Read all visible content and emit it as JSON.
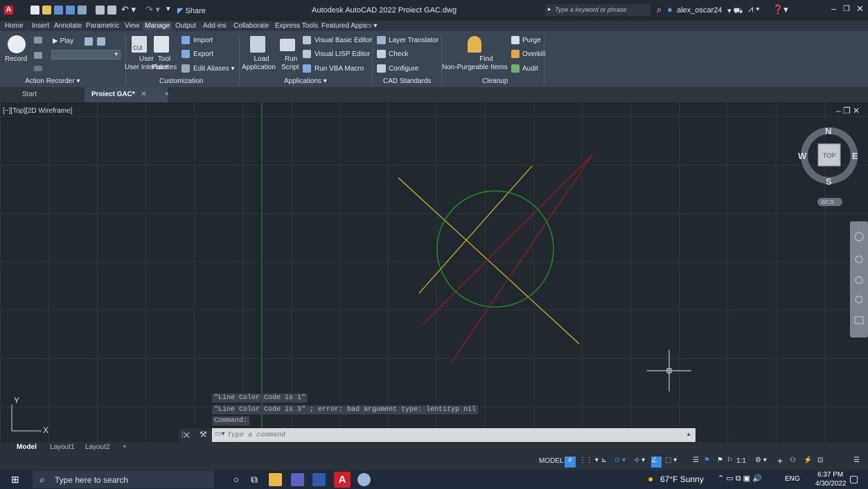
{
  "title_bar": {
    "app_title": "Autodesk AutoCAD 2022  Proiect GAC.dwg",
    "share_label": "Share",
    "search_placeholder": "Type a keyword or phrase",
    "user": "alex_oscar24"
  },
  "ribbon_tabs": [
    "Home",
    "Insert",
    "Annotate",
    "Parametric",
    "View",
    "Manage",
    "Output",
    "Add-ins",
    "Collaborate",
    "Express Tools",
    "Featured Apps"
  ],
  "active_tab": "Manage",
  "panels": {
    "action_recorder": {
      "title": "Action Recorder",
      "record": "Record",
      "play": "Play"
    },
    "customization": {
      "title": "Customization",
      "cui": "CUI",
      "user_interface": "User Interface",
      "tool_palettes_1": "Tool",
      "tool_palettes_2": "Palettes",
      "import": "Import",
      "export": "Export",
      "edit_aliases": "Edit Aliases"
    },
    "applications": {
      "title": "Applications",
      "load_1": "Load",
      "load_2": "Application",
      "run_1": "Run",
      "run_2": "Script",
      "vba_editor": "Visual Basic Editor",
      "lisp_editor": "Visual LISP Editor",
      "run_vba": "Run VBA Macro"
    },
    "cad_standards": {
      "title": "CAD Standards",
      "layer_translator": "Layer Translator",
      "check": "Check",
      "configure": "Configure"
    },
    "cleanup": {
      "title": "Cleanup",
      "find_1": "Find",
      "find_2": "Non-Purgeable Items",
      "purge": "Purge",
      "overkill": "Overkill",
      "audit": "Audit"
    }
  },
  "file_tabs": {
    "start": "Start",
    "current": "Proiect GAC*"
  },
  "viewport": {
    "label": "[−][Top][2D Wireframe]",
    "viewcube": {
      "n": "N",
      "s": "S",
      "e": "E",
      "w": "W",
      "top": "TOP",
      "wcs": "WCS"
    },
    "ucs_x": "X",
    "ucs_y": "Y"
  },
  "command": {
    "history": [
      "\"Line Color Code is 1\"",
      "\"Line Color Code is 3\" ; error: bad argument type: lentityp nil",
      "Command:"
    ],
    "placeholder": "Type a command"
  },
  "layout_tabs": [
    "Model",
    "Layout1",
    "Layout2"
  ],
  "status": {
    "model": "MODEL",
    "scale": "1:1"
  },
  "taskbar": {
    "search_placeholder": "Type here to search",
    "weather": "67°F  Sunny",
    "lang": "ENG",
    "time": "6:37 PM",
    "date": "4/30/2022"
  },
  "colors": {
    "accent": "#3b8ee6",
    "circle": "#1fa21f",
    "yellow_line": "#c8c21e",
    "red_line": "#a11b1b",
    "autocad_red": "#d0202c"
  }
}
